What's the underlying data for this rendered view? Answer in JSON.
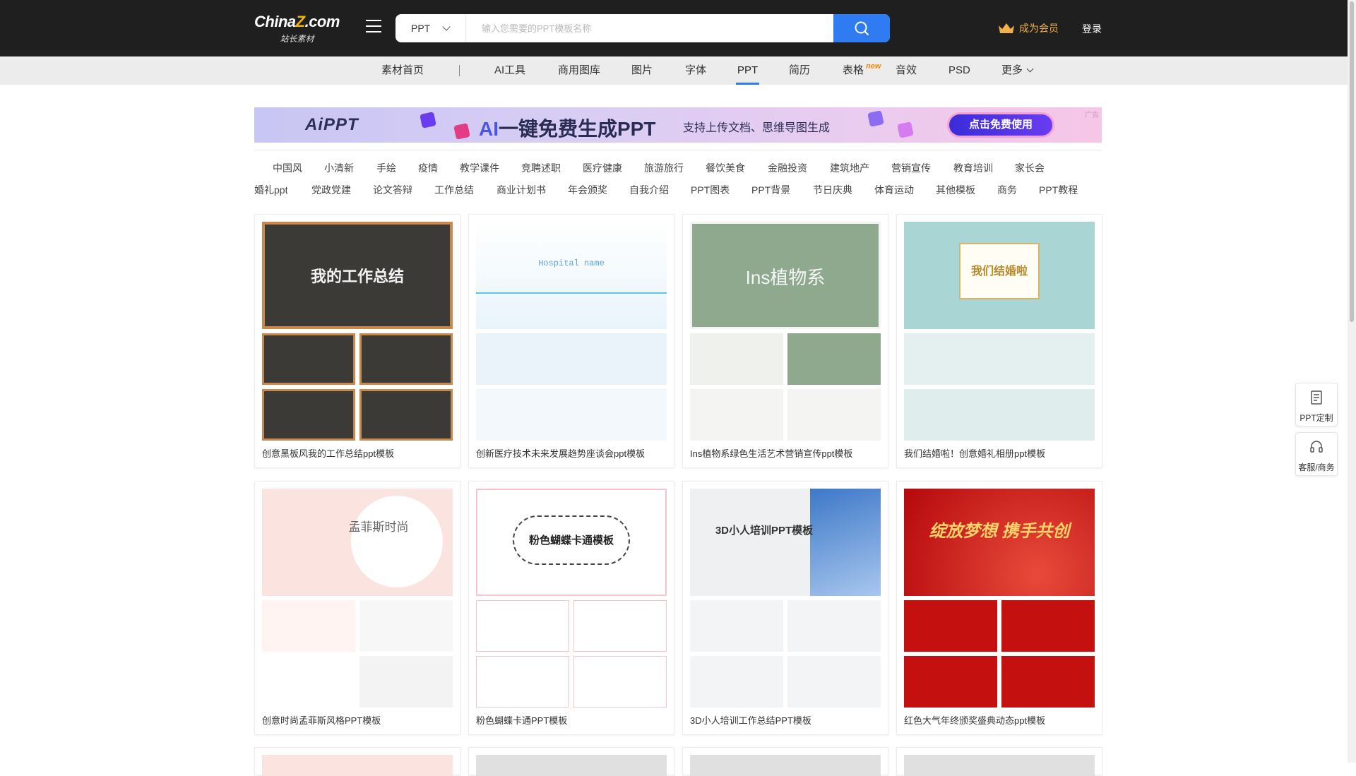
{
  "header": {
    "logo_main_a": "China",
    "logo_main_z": "Z",
    "logo_main_b": ".com",
    "logo_sub": "站长素材",
    "search_category": "PPT",
    "search_placeholder": "输入您需要的PPT模板名称",
    "vip_label": "成为会员",
    "login_label": "登录"
  },
  "nav": {
    "items": [
      "素材首页",
      "AI工具",
      "商用图库",
      "图片",
      "字体",
      "PPT",
      "简历",
      "表格",
      "音效",
      "PSD",
      "更多"
    ],
    "active": "PPT",
    "new_badge": "new"
  },
  "banner": {
    "logo": "AiPPT",
    "headline_ai": "AI",
    "headline_rest": "一键免费生成PPT",
    "tagline": "支持上传文档、思维导图生成",
    "cta": "点击免费使用",
    "ad": "广告"
  },
  "tags": {
    "row1": [
      "中国风",
      "小清新",
      "手绘",
      "疫情",
      "教学课件",
      "竞聘述职",
      "医疗健康",
      "旅游旅行",
      "餐饮美食",
      "金融投资",
      "建筑地产",
      "营销宣传",
      "教育培训",
      "家长会"
    ],
    "row2": [
      "婚礼ppt",
      "党政党建",
      "论文答辩",
      "工作总结",
      "商业计划书",
      "年会颁奖",
      "自我介绍",
      "PPT图表",
      "PPT背景",
      "节日庆典",
      "体育运动",
      "其他模板",
      "商务",
      "PPT教程"
    ]
  },
  "cards": [
    {
      "title": "创意黑板风我的工作总结ppt模板",
      "thumb_text": "我的工作总结"
    },
    {
      "title": "创新医疗技术未来发展趋势座谈会ppt模板",
      "thumb_text": "Hospital name"
    },
    {
      "title": "Ins植物系绿色生活艺术营销宣传ppt模板",
      "thumb_text": "Ins植物系"
    },
    {
      "title": "我们结婚啦！创意婚礼相册ppt模板",
      "thumb_text": "我们结婚啦"
    },
    {
      "title": "创意时尚孟菲斯风格PPT模板",
      "thumb_text": "孟菲斯时尚"
    },
    {
      "title": "粉色蝴蝶卡通PPT模板",
      "thumb_text": "粉色蝴蝶卡通模板"
    },
    {
      "title": "3D小人培训工作总结PPT模板",
      "thumb_text": "3D小人培训PPT模板"
    },
    {
      "title": "红色大气年终颁奖盛典动态ppt模板",
      "thumb_text": "绽放梦想 携手共创"
    }
  ],
  "side_tools": [
    {
      "label": "PPT定制",
      "icon": "document-icon"
    },
    {
      "label": "客服/商务",
      "icon": "headset-icon"
    }
  ],
  "colors": {
    "topbar": "#1f1f1f",
    "accent": "#2f7bf1",
    "vip": "#f0b14a"
  }
}
